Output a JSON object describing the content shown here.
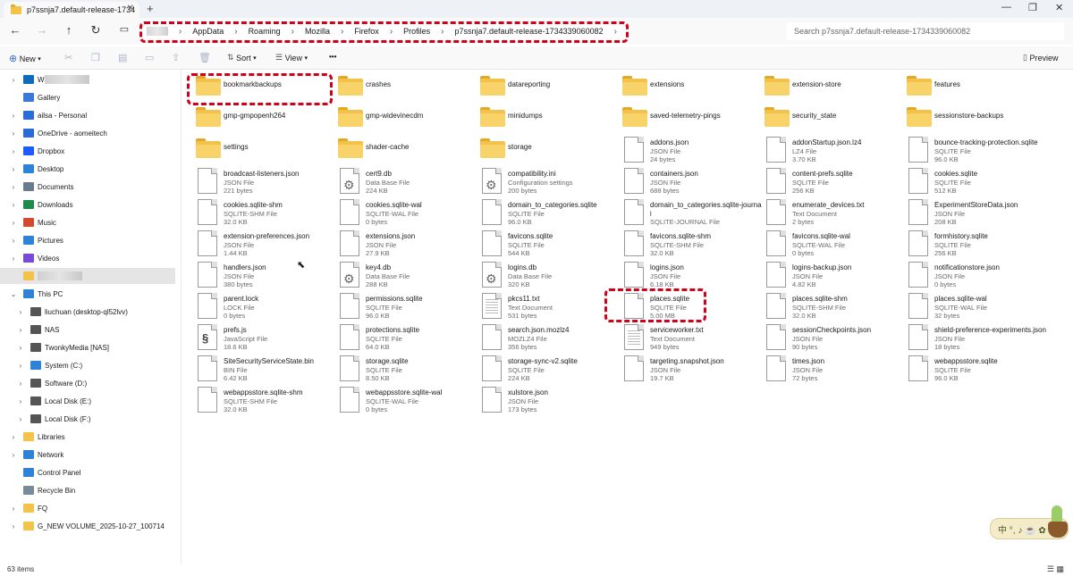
{
  "window": {
    "tab_title": "p7ssnja7.default-release-1734",
    "tab_close": "✕",
    "new_tab": "+",
    "minimize": "—",
    "maximize": "❐",
    "close": "✕"
  },
  "nav": {
    "back": "←",
    "forward": "→",
    "up": "↑",
    "refresh": "↻",
    "breadcrumb": [
      "AppData",
      "Roaming",
      "Mozilla",
      "Firefox",
      "Profiles",
      "p7ssnja7.default-release-1734339060082"
    ],
    "search_placeholder": "Search p7ssnja7.default-release-1734339060082"
  },
  "toolbar": {
    "new_label": "New",
    "sort_label": "Sort",
    "view_label": "View",
    "more_label": "•••",
    "preview_label": "Preview"
  },
  "sidebar": {
    "items": [
      {
        "label": "W",
        "icon": "cloud-icon",
        "color": "#0f6cbd"
      },
      {
        "label": "Gallery",
        "icon": "gallery-icon",
        "color": "#3b78d8"
      },
      {
        "label": "ailsa - Personal",
        "icon": "onedrive-icon",
        "color": "#2b6bd6"
      },
      {
        "label": "OneDrive - aomeitech",
        "icon": "onedrive-icon",
        "color": "#2b6bd6"
      },
      {
        "label": "Dropbox",
        "icon": "dropbox-icon",
        "color": "#1e5bff"
      },
      {
        "label": "Desktop",
        "icon": "desktop-icon",
        "color": "#2f83d6"
      },
      {
        "label": "Documents",
        "icon": "documents-icon",
        "color": "#6a7a8c"
      },
      {
        "label": "Downloads",
        "icon": "downloads-icon",
        "color": "#1f8a4c"
      },
      {
        "label": "Music",
        "icon": "music-icon",
        "color": "#d44a2f"
      },
      {
        "label": "Pictures",
        "icon": "pictures-icon",
        "color": "#2f83d6"
      },
      {
        "label": "Videos",
        "icon": "videos-icon",
        "color": "#7a4bd6"
      },
      {
        "label": "",
        "icon": "folder-icon",
        "color": "#f2c24a"
      },
      {
        "label": "This PC",
        "icon": "pc-icon",
        "color": "#2f83d6"
      },
      {
        "label": "liuchuan (desktop-ql52lvv)",
        "icon": "network-drive-icon",
        "color": "#555555"
      },
      {
        "label": "NAS",
        "icon": "network-drive-icon",
        "color": "#555555"
      },
      {
        "label": "TwonkyMedia [NAS]",
        "icon": "network-drive-icon",
        "color": "#555555"
      },
      {
        "label": "System (C:)",
        "icon": "drive-icon",
        "color": "#2f83d6"
      },
      {
        "label": "Software (D:)",
        "icon": "drive-icon",
        "color": "#555555"
      },
      {
        "label": "Local Disk (E:)",
        "icon": "drive-icon",
        "color": "#555555"
      },
      {
        "label": "Local Disk (F:)",
        "icon": "drive-icon",
        "color": "#555555"
      },
      {
        "label": "Libraries",
        "icon": "folder-icon",
        "color": "#f2c24a"
      },
      {
        "label": "Network",
        "icon": "network-icon",
        "color": "#2f83d6"
      },
      {
        "label": "Control Panel",
        "icon": "control-panel-icon",
        "color": "#2f83d6"
      },
      {
        "label": "Recycle Bin",
        "icon": "recycle-bin-icon",
        "color": "#7a8a9a"
      },
      {
        "label": "FQ",
        "icon": "folder-icon",
        "color": "#f2c24a"
      },
      {
        "label": "G_NEW VOLUME_2025-10-27_100714",
        "icon": "folder-icon",
        "color": "#f2c24a"
      }
    ]
  },
  "files": [
    {
      "name": "bookmarkbackups",
      "kind": "folder"
    },
    {
      "name": "crashes",
      "kind": "folder"
    },
    {
      "name": "datareporting",
      "kind": "folder"
    },
    {
      "name": "extensions",
      "kind": "folder"
    },
    {
      "name": "extension-store",
      "kind": "folder"
    },
    {
      "name": "features",
      "kind": "folder"
    },
    {
      "name": "gmp-gmpopenh264",
      "kind": "folder"
    },
    {
      "name": "gmp-widevinecdm",
      "kind": "folder"
    },
    {
      "name": "minidumps",
      "kind": "folder"
    },
    {
      "name": "saved-telemetry-pings",
      "kind": "folder"
    },
    {
      "name": "security_state",
      "kind": "folder"
    },
    {
      "name": "sessionstore-backups",
      "kind": "folder"
    },
    {
      "name": "settings",
      "kind": "folder"
    },
    {
      "name": "shader-cache",
      "kind": "folder"
    },
    {
      "name": "storage",
      "kind": "folder"
    },
    {
      "name": "addons.json",
      "type": "JSON File",
      "size": "24 bytes",
      "kind": "file"
    },
    {
      "name": "addonStartup.json.lz4",
      "type": "LZ4 File",
      "size": "3.70 KB",
      "kind": "file"
    },
    {
      "name": "bounce-tracking-protection.sqlite",
      "type": "SQLITE File",
      "size": "96.0 KB",
      "kind": "file"
    },
    {
      "name": "broadcast-listeners.json",
      "type": "JSON File",
      "size": "221 bytes",
      "kind": "file"
    },
    {
      "name": "cert9.db",
      "type": "Data Base File",
      "size": "224 KB",
      "kind": "gear"
    },
    {
      "name": "compatibility.ini",
      "type": "Configuration settings",
      "size": "200 bytes",
      "kind": "gear"
    },
    {
      "name": "containers.json",
      "type": "JSON File",
      "size": "688 bytes",
      "kind": "file"
    },
    {
      "name": "content-prefs.sqlite",
      "type": "SQLITE File",
      "size": "256 KB",
      "kind": "file"
    },
    {
      "name": "cookies.sqlite",
      "type": "SQLITE File",
      "size": "512 KB",
      "kind": "file"
    },
    {
      "name": "cookies.sqlite-shm",
      "type": "SQLITE-SHM File",
      "size": "32.0 KB",
      "kind": "file"
    },
    {
      "name": "cookies.sqlite-wal",
      "type": "SQLITE-WAL File",
      "size": "0 bytes",
      "kind": "file"
    },
    {
      "name": "domain_to_categories.sqlite",
      "type": "SQLITE File",
      "size": "96.0 KB",
      "kind": "file"
    },
    {
      "name": "domain_to_categories.sqlite-journa",
      "name2": "l",
      "type": "SQLITE-JOURNAL File",
      "size": "",
      "kind": "file"
    },
    {
      "name": "enumerate_devices.txt",
      "type": "Text Document",
      "size": "2 bytes",
      "kind": "file"
    },
    {
      "name": "ExperimentStoreData.json",
      "type": "JSON File",
      "size": "208 KB",
      "kind": "file"
    },
    {
      "name": "extension-preferences.json",
      "type": "JSON File",
      "size": "1.44 KB",
      "kind": "file"
    },
    {
      "name": "extensions.json",
      "type": "JSON File",
      "size": "27.9 KB",
      "kind": "file"
    },
    {
      "name": "favicons.sqlite",
      "type": "SQLITE File",
      "size": "544 KB",
      "kind": "file"
    },
    {
      "name": "favicons.sqlite-shm",
      "type": "SQLITE-SHM File",
      "size": "32.0 KB",
      "kind": "file"
    },
    {
      "name": "favicons.sqlite-wal",
      "type": "SQLITE-WAL File",
      "size": "0 bytes",
      "kind": "file"
    },
    {
      "name": "formhistory.sqlite",
      "type": "SQLITE File",
      "size": "256 KB",
      "kind": "file"
    },
    {
      "name": "handlers.json",
      "type": "JSON File",
      "size": "380 bytes",
      "kind": "file"
    },
    {
      "name": "key4.db",
      "type": "Data Base File",
      "size": "288 KB",
      "kind": "gear"
    },
    {
      "name": "logins.db",
      "type": "Data Base File",
      "size": "320 KB",
      "kind": "gear"
    },
    {
      "name": "logins.json",
      "type": "JSON File",
      "size": "6.18 KB",
      "kind": "file"
    },
    {
      "name": "logins-backup.json",
      "type": "JSON File",
      "size": "4.82 KB",
      "kind": "file"
    },
    {
      "name": "notificationstore.json",
      "type": "JSON File",
      "size": "0 bytes",
      "kind": "file"
    },
    {
      "name": "parent.lock",
      "type": "LOCK File",
      "size": "0 bytes",
      "kind": "file"
    },
    {
      "name": "permissions.sqlite",
      "type": "SQLITE File",
      "size": "96.0 KB",
      "kind": "file"
    },
    {
      "name": "pkcs11.txt",
      "type": "Text Document",
      "size": "531 bytes",
      "kind": "lines"
    },
    {
      "name": "places.sqlite",
      "type": "SQLITE File",
      "size": "5.00 MB",
      "kind": "file"
    },
    {
      "name": "places.sqlite-shm",
      "type": "SQLITE-SHM File",
      "size": "32.0 KB",
      "kind": "file"
    },
    {
      "name": "places.sqlite-wal",
      "type": "SQLITE-WAL File",
      "size": "32 bytes",
      "kind": "file"
    },
    {
      "name": "prefs.js",
      "type": "JavaScript File",
      "size": "18.6 KB",
      "kind": "js"
    },
    {
      "name": "protections.sqlite",
      "type": "SQLITE File",
      "size": "64.0 KB",
      "kind": "file"
    },
    {
      "name": "search.json.mozlz4",
      "type": "MOZLZ4 File",
      "size": "356 bytes",
      "kind": "file"
    },
    {
      "name": "serviceworker.txt",
      "type": "Text Document",
      "size": "949 bytes",
      "kind": "lines"
    },
    {
      "name": "sessionCheckpoints.json",
      "type": "JSON File",
      "size": "90 bytes",
      "kind": "file"
    },
    {
      "name": "shield-preference-experiments.json",
      "type": "JSON File",
      "size": "18 bytes",
      "kind": "file"
    },
    {
      "name": "SiteSecurityServiceState.bin",
      "type": "BIN File",
      "size": "6.42 KB",
      "kind": "file"
    },
    {
      "name": "storage.sqlite",
      "type": "SQLITE File",
      "size": "8.50 KB",
      "kind": "file"
    },
    {
      "name": "storage-sync-v2.sqlite",
      "type": "SQLITE File",
      "size": "224 KB",
      "kind": "file"
    },
    {
      "name": "targeting.snapshot.json",
      "type": "JSON File",
      "size": "19.7 KB",
      "kind": "file"
    },
    {
      "name": "times.json",
      "type": "JSON File",
      "size": "72 bytes",
      "kind": "file"
    },
    {
      "name": "webappsstore.sqlite",
      "type": "SQLITE File",
      "size": "96.0 KB",
      "kind": "file"
    },
    {
      "name": "webappsstore.sqlite-shm",
      "type": "SQLITE-SHM File",
      "size": "32.0 KB",
      "kind": "file"
    },
    {
      "name": "webappsstore.sqlite-wal",
      "type": "SQLITE-WAL File",
      "size": "0 bytes",
      "kind": "file"
    },
    {
      "name": "xulstore.json",
      "type": "JSON File",
      "size": "173 bytes",
      "kind": "file"
    }
  ],
  "status": {
    "item_count": "63 items"
  },
  "widget": {
    "text": "中 °, ♪ ☕ ✿"
  },
  "colors": {
    "highlight": "#d0021b",
    "folder": "#f2c24a"
  }
}
